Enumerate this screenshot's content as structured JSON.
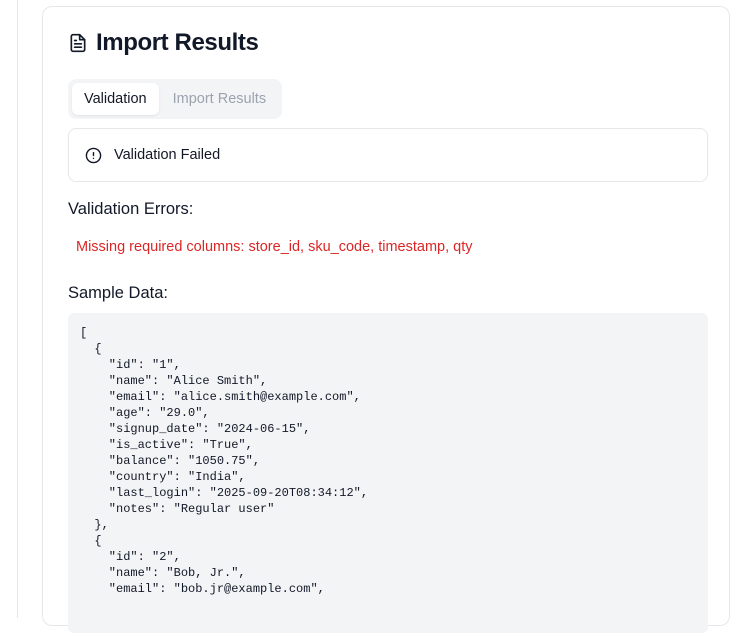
{
  "header": {
    "title": "Import Results",
    "icon": "file-text-icon"
  },
  "tabs": [
    {
      "label": "Validation",
      "active": true
    },
    {
      "label": "Import Results",
      "active": false
    }
  ],
  "alert": {
    "icon": "alert-circle-icon",
    "title": "Validation Failed"
  },
  "errors": {
    "heading": "Validation Errors:",
    "items": [
      "Missing required columns: store_id, sku_code, timestamp, qty"
    ]
  },
  "sample": {
    "heading": "Sample Data:",
    "json": "[\n  {\n    \"id\": \"1\",\n    \"name\": \"Alice Smith\",\n    \"email\": \"alice.smith@example.com\",\n    \"age\": \"29.0\",\n    \"signup_date\": \"2024-06-15\",\n    \"is_active\": \"True\",\n    \"balance\": \"1050.75\",\n    \"country\": \"India\",\n    \"last_login\": \"2025-09-20T08:34:12\",\n    \"notes\": \"Regular user\"\n  },\n  {\n    \"id\": \"2\",\n    \"name\": \"Bob, Jr.\",\n    \"email\": \"bob.jr@example.com\","
  },
  "colors": {
    "error": "#dc2626",
    "muted": "#9ca3af",
    "border": "#e5e7eb",
    "code_bg": "#f3f4f6"
  }
}
